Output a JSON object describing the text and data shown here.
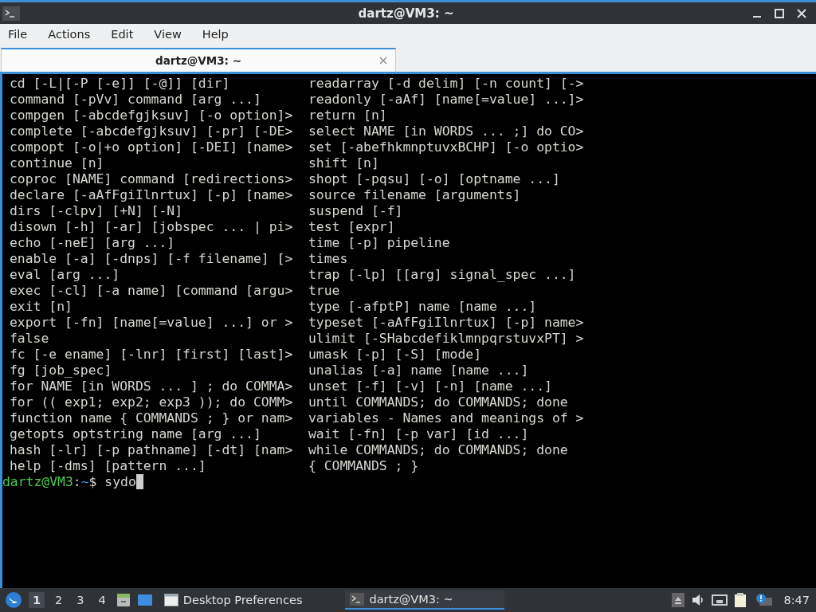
{
  "window": {
    "title": "dartz@VM3: ~"
  },
  "menu": [
    "File",
    "Actions",
    "Edit",
    "View",
    "Help"
  ],
  "tabs": [
    {
      "label": "dartz@VM3: ~",
      "selected": true
    }
  ],
  "terminal": {
    "rows": [
      [
        "cd [-L|[-P [-e]] [-@]] [dir]",
        "readarray [-d delim] [-n count] [->"
      ],
      [
        "command [-pVv] command [arg ...]",
        "readonly [-aAf] [name[=value] ...]>"
      ],
      [
        "compgen [-abcdefgjksuv] [-o option]>",
        "return [n]"
      ],
      [
        "complete [-abcdefgjksuv] [-pr] [-DE>",
        "select NAME [in WORDS ... ;] do CO>"
      ],
      [
        "compopt [-o|+o option] [-DEI] [name>",
        "set [-abefhkmnptuvxBCHP] [-o optio>"
      ],
      [
        "continue [n]",
        "shift [n]"
      ],
      [
        "coproc [NAME] command [redirections>",
        "shopt [-pqsu] [-o] [optname ...]"
      ],
      [
        "declare [-aAfFgiIlnrtux] [-p] [name>",
        "source filename [arguments]"
      ],
      [
        "dirs [-clpv] [+N] [-N]",
        "suspend [-f]"
      ],
      [
        "disown [-h] [-ar] [jobspec ... | pi>",
        "test [expr]"
      ],
      [
        "echo [-neE] [arg ...]",
        "time [-p] pipeline"
      ],
      [
        "enable [-a] [-dnps] [-f filename] [>",
        "times"
      ],
      [
        "eval [arg ...]",
        "trap [-lp] [[arg] signal_spec ...]"
      ],
      [
        "exec [-cl] [-a name] [command [argu>",
        "true"
      ],
      [
        "exit [n]",
        "type [-afptP] name [name ...]"
      ],
      [
        "export [-fn] [name[=value] ...] or >",
        "typeset [-aAfFgiIlnrtux] [-p] name>"
      ],
      [
        "false",
        "ulimit [-SHabcdefiklmnpqrstuvxPT] >"
      ],
      [
        "fc [-e ename] [-lnr] [first] [last]>",
        "umask [-p] [-S] [mode]"
      ],
      [
        "fg [job_spec]",
        "unalias [-a] name [name ...]"
      ],
      [
        "for NAME [in WORDS ... ] ; do COMMA>",
        "unset [-f] [-v] [-n] [name ...]"
      ],
      [
        "for (( exp1; exp2; exp3 )); do COMM>",
        "until COMMANDS; do COMMANDS; done"
      ],
      [
        "function name { COMMANDS ; } or nam>",
        "variables - Names and meanings of >"
      ],
      [
        "getopts optstring name [arg ...]",
        "wait [-fn] [-p var] [id ...]"
      ],
      [
        "hash [-lr] [-p pathname] [-dt] [nam>",
        "while COMMANDS; do COMMANDS; done"
      ],
      [
        "help [-dms] [pattern ...]",
        "{ COMMANDS ; }"
      ]
    ],
    "prompt": {
      "user_host": "dartz@VM3",
      "separator": ":",
      "path": "~",
      "symbol": "$",
      "input": "sydo"
    }
  },
  "taskbar": {
    "workspaces": [
      {
        "label": "1",
        "selected": true
      },
      {
        "label": "2",
        "selected": false
      },
      {
        "label": "3",
        "selected": false
      },
      {
        "label": "4",
        "selected": false
      }
    ],
    "tasks": [
      {
        "label": "Desktop Preferences",
        "selected": false
      },
      {
        "label": "dartz@VM3: ~",
        "selected": true
      }
    ],
    "clock": "8:47"
  }
}
